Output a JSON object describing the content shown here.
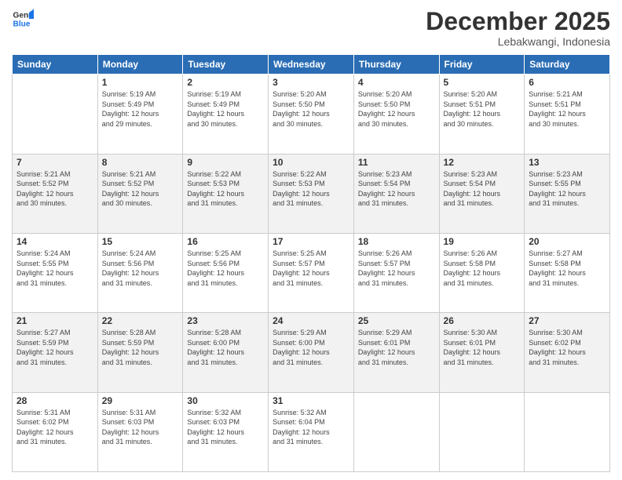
{
  "header": {
    "logo": {
      "line1": "General",
      "line2": "Blue"
    },
    "title": "December 2025",
    "location": "Lebakwangi, Indonesia"
  },
  "columns": [
    "Sunday",
    "Monday",
    "Tuesday",
    "Wednesday",
    "Thursday",
    "Friday",
    "Saturday"
  ],
  "weeks": [
    [
      {
        "day": "",
        "info": ""
      },
      {
        "day": "1",
        "info": "Sunrise: 5:19 AM\nSunset: 5:49 PM\nDaylight: 12 hours\nand 29 minutes."
      },
      {
        "day": "2",
        "info": "Sunrise: 5:19 AM\nSunset: 5:49 PM\nDaylight: 12 hours\nand 30 minutes."
      },
      {
        "day": "3",
        "info": "Sunrise: 5:20 AM\nSunset: 5:50 PM\nDaylight: 12 hours\nand 30 minutes."
      },
      {
        "day": "4",
        "info": "Sunrise: 5:20 AM\nSunset: 5:50 PM\nDaylight: 12 hours\nand 30 minutes."
      },
      {
        "day": "5",
        "info": "Sunrise: 5:20 AM\nSunset: 5:51 PM\nDaylight: 12 hours\nand 30 minutes."
      },
      {
        "day": "6",
        "info": "Sunrise: 5:21 AM\nSunset: 5:51 PM\nDaylight: 12 hours\nand 30 minutes."
      }
    ],
    [
      {
        "day": "7",
        "info": "Sunrise: 5:21 AM\nSunset: 5:52 PM\nDaylight: 12 hours\nand 30 minutes."
      },
      {
        "day": "8",
        "info": "Sunrise: 5:21 AM\nSunset: 5:52 PM\nDaylight: 12 hours\nand 30 minutes."
      },
      {
        "day": "9",
        "info": "Sunrise: 5:22 AM\nSunset: 5:53 PM\nDaylight: 12 hours\nand 31 minutes."
      },
      {
        "day": "10",
        "info": "Sunrise: 5:22 AM\nSunset: 5:53 PM\nDaylight: 12 hours\nand 31 minutes."
      },
      {
        "day": "11",
        "info": "Sunrise: 5:23 AM\nSunset: 5:54 PM\nDaylight: 12 hours\nand 31 minutes."
      },
      {
        "day": "12",
        "info": "Sunrise: 5:23 AM\nSunset: 5:54 PM\nDaylight: 12 hours\nand 31 minutes."
      },
      {
        "day": "13",
        "info": "Sunrise: 5:23 AM\nSunset: 5:55 PM\nDaylight: 12 hours\nand 31 minutes."
      }
    ],
    [
      {
        "day": "14",
        "info": "Sunrise: 5:24 AM\nSunset: 5:55 PM\nDaylight: 12 hours\nand 31 minutes."
      },
      {
        "day": "15",
        "info": "Sunrise: 5:24 AM\nSunset: 5:56 PM\nDaylight: 12 hours\nand 31 minutes."
      },
      {
        "day": "16",
        "info": "Sunrise: 5:25 AM\nSunset: 5:56 PM\nDaylight: 12 hours\nand 31 minutes."
      },
      {
        "day": "17",
        "info": "Sunrise: 5:25 AM\nSunset: 5:57 PM\nDaylight: 12 hours\nand 31 minutes."
      },
      {
        "day": "18",
        "info": "Sunrise: 5:26 AM\nSunset: 5:57 PM\nDaylight: 12 hours\nand 31 minutes."
      },
      {
        "day": "19",
        "info": "Sunrise: 5:26 AM\nSunset: 5:58 PM\nDaylight: 12 hours\nand 31 minutes."
      },
      {
        "day": "20",
        "info": "Sunrise: 5:27 AM\nSunset: 5:58 PM\nDaylight: 12 hours\nand 31 minutes."
      }
    ],
    [
      {
        "day": "21",
        "info": "Sunrise: 5:27 AM\nSunset: 5:59 PM\nDaylight: 12 hours\nand 31 minutes."
      },
      {
        "day": "22",
        "info": "Sunrise: 5:28 AM\nSunset: 5:59 PM\nDaylight: 12 hours\nand 31 minutes."
      },
      {
        "day": "23",
        "info": "Sunrise: 5:28 AM\nSunset: 6:00 PM\nDaylight: 12 hours\nand 31 minutes."
      },
      {
        "day": "24",
        "info": "Sunrise: 5:29 AM\nSunset: 6:00 PM\nDaylight: 12 hours\nand 31 minutes."
      },
      {
        "day": "25",
        "info": "Sunrise: 5:29 AM\nSunset: 6:01 PM\nDaylight: 12 hours\nand 31 minutes."
      },
      {
        "day": "26",
        "info": "Sunrise: 5:30 AM\nSunset: 6:01 PM\nDaylight: 12 hours\nand 31 minutes."
      },
      {
        "day": "27",
        "info": "Sunrise: 5:30 AM\nSunset: 6:02 PM\nDaylight: 12 hours\nand 31 minutes."
      }
    ],
    [
      {
        "day": "28",
        "info": "Sunrise: 5:31 AM\nSunset: 6:02 PM\nDaylight: 12 hours\nand 31 minutes."
      },
      {
        "day": "29",
        "info": "Sunrise: 5:31 AM\nSunset: 6:03 PM\nDaylight: 12 hours\nand 31 minutes."
      },
      {
        "day": "30",
        "info": "Sunrise: 5:32 AM\nSunset: 6:03 PM\nDaylight: 12 hours\nand 31 minutes."
      },
      {
        "day": "31",
        "info": "Sunrise: 5:32 AM\nSunset: 6:04 PM\nDaylight: 12 hours\nand 31 minutes."
      },
      {
        "day": "",
        "info": ""
      },
      {
        "day": "",
        "info": ""
      },
      {
        "day": "",
        "info": ""
      }
    ]
  ]
}
